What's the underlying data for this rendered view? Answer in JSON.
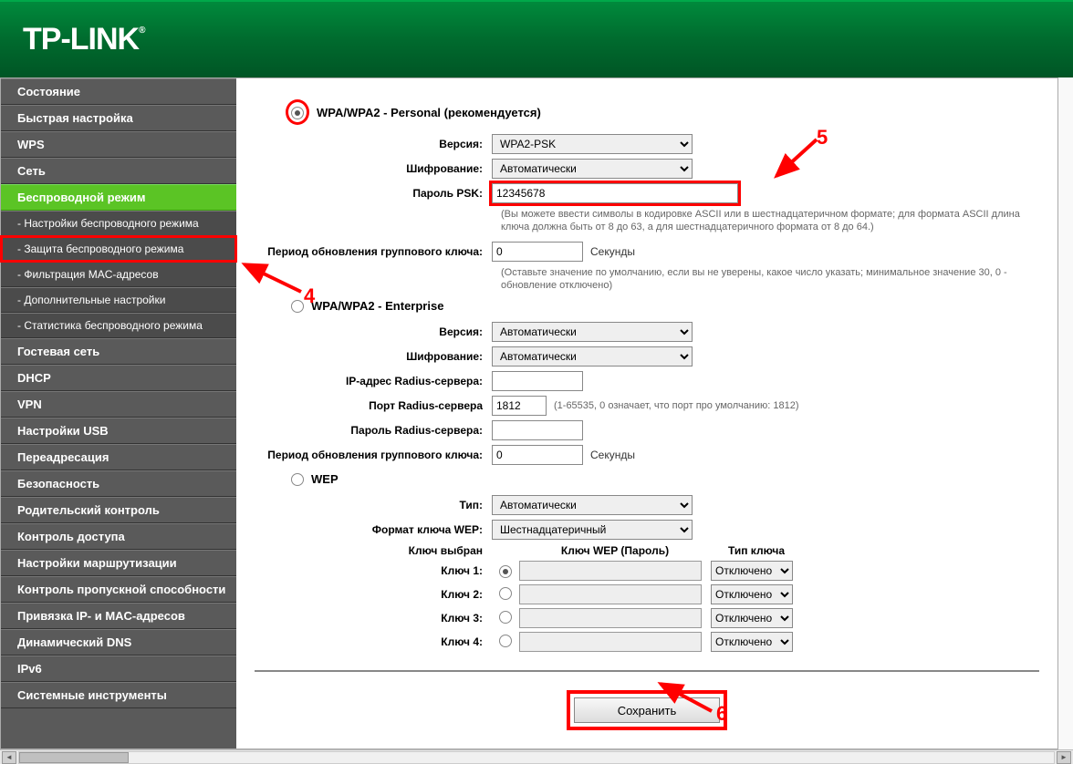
{
  "logo": "TP-LINK",
  "sidebar": {
    "items": [
      {
        "label": "Состояние",
        "type": "item"
      },
      {
        "label": "Быстрая настройка",
        "type": "item"
      },
      {
        "label": "WPS",
        "type": "item"
      },
      {
        "label": "Сеть",
        "type": "item"
      },
      {
        "label": "Беспроводной режим",
        "type": "item",
        "active": true
      },
      {
        "label": "- Настройки беспроводного режима",
        "type": "sub"
      },
      {
        "label": "- Защита беспроводного режима",
        "type": "sub",
        "selected": true
      },
      {
        "label": "- Фильтрация MAC-адресов",
        "type": "sub"
      },
      {
        "label": "- Дополнительные настройки",
        "type": "sub"
      },
      {
        "label": "- Статистика беспроводного режима",
        "type": "sub"
      },
      {
        "label": "Гостевая сеть",
        "type": "item"
      },
      {
        "label": "DHCP",
        "type": "item"
      },
      {
        "label": "VPN",
        "type": "item"
      },
      {
        "label": "Настройки USB",
        "type": "item"
      },
      {
        "label": "Переадресация",
        "type": "item"
      },
      {
        "label": "Безопасность",
        "type": "item"
      },
      {
        "label": "Родительский контроль",
        "type": "item"
      },
      {
        "label": "Контроль доступа",
        "type": "item"
      },
      {
        "label": "Настройки маршрутизации",
        "type": "item"
      },
      {
        "label": "Контроль пропускной способности",
        "type": "item"
      },
      {
        "label": "Привязка IP- и MAC-адресов",
        "type": "item"
      },
      {
        "label": "Динамический DNS",
        "type": "item"
      },
      {
        "label": "IPv6",
        "type": "item"
      },
      {
        "label": "Системные инструменты",
        "type": "item"
      }
    ]
  },
  "sections": {
    "personal": {
      "title": "WPA/WPA2 - Personal (рекомендуется)",
      "version_label": "Версия:",
      "version_value": "WPA2-PSK",
      "enc_label": "Шифрование:",
      "enc_value": "Автоматически",
      "psk_label": "Пароль PSK:",
      "psk_value": "12345678",
      "psk_hint": "(Вы можете ввести символы в кодировке ASCII или в шестнадцатеричном формате; для формата ASCII длина ключа должна быть от 8 до 63, а для шестнадцатеричного формата от 8 до 64.)",
      "group_label": "Период обновления группового ключа:",
      "group_value": "0",
      "group_unit": "Секунды",
      "group_hint": "(Оставьте значение по умолчанию, если вы не уверены, какое число указать; минимальное значение 30, 0 - обновление отключено)"
    },
    "enterprise": {
      "title": "WPA/WPA2 - Enterprise",
      "version_label": "Версия:",
      "version_value": "Автоматически",
      "enc_label": "Шифрование:",
      "enc_value": "Автоматически",
      "ip_label": "IP-адрес Radius-сервера:",
      "ip_value": "",
      "port_label": "Порт Radius-сервера",
      "port_value": "1812",
      "port_hint": "(1-65535, 0 означает, что порт про умолчанию: 1812)",
      "pass_label": "Пароль Radius-сервера:",
      "pass_value": "",
      "group_label": "Период обновления группового ключа:",
      "group_value": "0",
      "group_unit": "Секунды"
    },
    "wep": {
      "title": "WEP",
      "type_label": "Тип:",
      "type_value": "Автоматически",
      "format_label": "Формат ключа WEP:",
      "format_value": "Шестнадцатеричный",
      "selected_label": "Ключ выбран",
      "col_key": "Ключ WEP (Пароль)",
      "col_type": "Тип ключа",
      "keys": [
        {
          "label": "Ключ 1:",
          "value": "",
          "type": "Отключено"
        },
        {
          "label": "Ключ 2:",
          "value": "",
          "type": "Отключено"
        },
        {
          "label": "Ключ 3:",
          "value": "",
          "type": "Отключено"
        },
        {
          "label": "Ключ 4:",
          "value": "",
          "type": "Отключено"
        }
      ]
    }
  },
  "save_label": "Сохранить",
  "annotations": {
    "n4": "4",
    "n5": "5",
    "n6": "6"
  }
}
